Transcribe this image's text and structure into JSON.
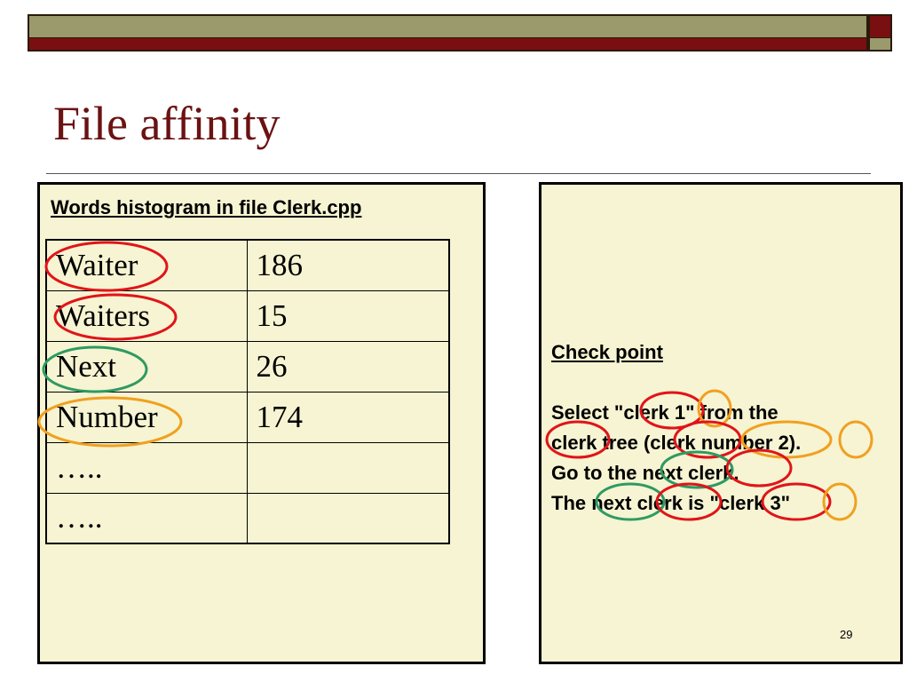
{
  "slide": {
    "title": "File affinity",
    "page_number": "29"
  },
  "left_panel": {
    "heading": "Words histogram in file Clerk.cpp",
    "rows": [
      {
        "word": "Waiter",
        "count": "186"
      },
      {
        "word": "Waiters",
        "count": "15"
      },
      {
        "word": "Next",
        "count": "26"
      },
      {
        "word": "Number",
        "count": "174"
      },
      {
        "word": "…..",
        "count": ""
      },
      {
        "word": "…..",
        "count": ""
      }
    ]
  },
  "right_panel": {
    "heading": "Check point",
    "lines": [
      "Select \"clerk 1\" from the",
      "clerk tree (clerk number 2).",
      "Go to the next clerk.",
      "The next clerk is \"clerk 3\""
    ]
  },
  "colors": {
    "title": "#6b1212",
    "panel_fill": "#f6f4d2",
    "bar_olive": "#9a9a6c",
    "bar_red": "#7a0f12",
    "highlight_red": "#e0141a",
    "highlight_green": "#2e9a62",
    "highlight_orange": "#f0a020"
  }
}
